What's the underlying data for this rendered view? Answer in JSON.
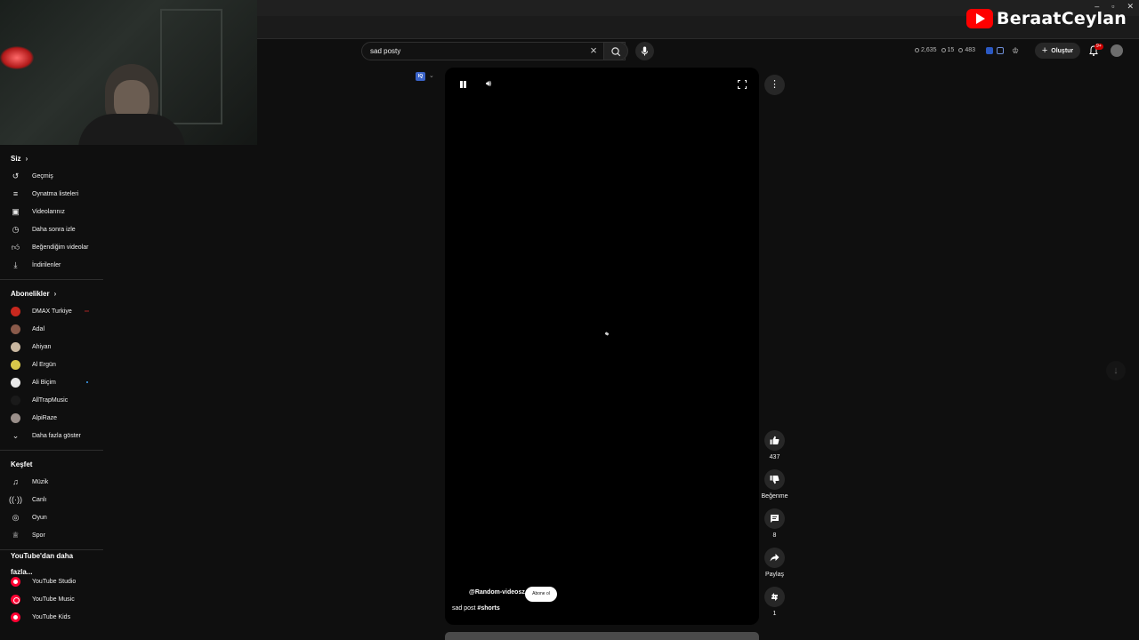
{
  "brand": {
    "name": "BeraatCeylan"
  },
  "header": {
    "search_value": "sad posty",
    "stats": {
      "points": "2,635",
      "streak": "15",
      "views": "483"
    },
    "create_label": "Oluştur",
    "notification_badge": "9+"
  },
  "sidebar": {
    "you_section": {
      "title": "Siz",
      "items": [
        {
          "label": "Geçmiş",
          "icon": "history-icon"
        },
        {
          "label": "Oynatma listeleri",
          "icon": "playlists-icon"
        },
        {
          "label": "Videolarınız",
          "icon": "your-videos-icon"
        },
        {
          "label": "Daha sonra izle",
          "icon": "watch-later-icon"
        },
        {
          "label": "Beğendiğim videolar",
          "icon": "liked-videos-icon"
        },
        {
          "label": "İndirilenler",
          "icon": "downloads-icon"
        }
      ]
    },
    "subscriptions": {
      "title": "Abonelikler",
      "items": [
        {
          "label": "DMAX Turkiye",
          "color": "#c8281e"
        },
        {
          "label": "Adal",
          "color": "#8a5a4a"
        },
        {
          "label": "Ahiyan",
          "color": "#c9b7a0"
        },
        {
          "label": "Al Ergün",
          "color": "#d8c84a"
        },
        {
          "label": "Ali Biçim",
          "color": "#e8e8e8"
        },
        {
          "label": "AllTrapMusic",
          "color": "#1a1a1a"
        },
        {
          "label": "AlpiRaze",
          "color": "#9a8f8a"
        }
      ],
      "show_more": "Daha fazla göster"
    },
    "explore": {
      "title": "Keşfet",
      "items": [
        {
          "label": "Müzik",
          "icon": "music-icon"
        },
        {
          "label": "Canlı",
          "icon": "live-icon"
        },
        {
          "label": "Oyun",
          "icon": "gaming-icon"
        },
        {
          "label": "Spor",
          "icon": "trophy-icon"
        }
      ]
    },
    "more_from_youtube": {
      "title": "YouTube'dan daha fazla...",
      "items": [
        {
          "label": "YouTube Studio"
        },
        {
          "label": "YouTube Music"
        },
        {
          "label": "YouTube Kids"
        }
      ]
    }
  },
  "player": {
    "channel_handle": "@Random-videosz",
    "subscribe_label": "Abone ol",
    "title_text": "sad post ",
    "hashtag": "#shorts"
  },
  "actions": {
    "likes": "437",
    "dislike_label": "Beğenme",
    "comments": "8",
    "share_label": "Paylaş",
    "remix": "1"
  }
}
